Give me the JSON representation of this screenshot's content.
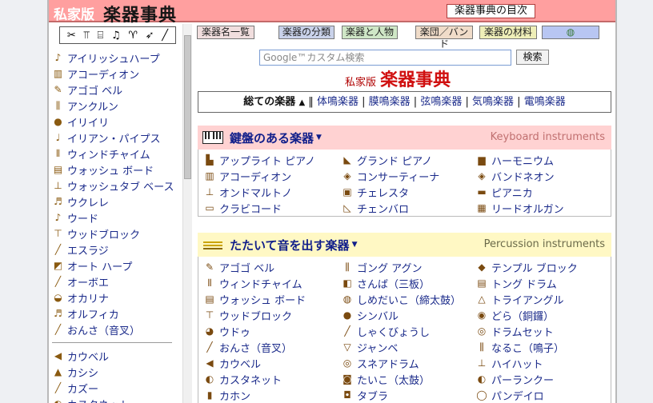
{
  "header": {
    "site_prefix": "私家版",
    "site_title": "楽器事典",
    "toc_link": "楽器事典の目次"
  },
  "tabs": [
    {
      "label": "楽器名一覧",
      "color": "#f1dede"
    },
    {
      "label": "楽器の分類",
      "color": "#c9d2ea"
    },
    {
      "label": "楽器と人物",
      "color": "#cfe7c6"
    },
    {
      "label": "楽団／バンド",
      "color": "#f0dcc9"
    },
    {
      "label": "楽器の材料",
      "color": "#efefb8"
    },
    {
      "label": "",
      "color": "#b8c6f2"
    }
  ],
  "search": {
    "placeholder": "Google™カスタム検索",
    "button": "検索"
  },
  "brand": {
    "prefix": "私家版",
    "title": "楽器事典"
  },
  "category_bar": {
    "all": "総ての楽器",
    "arrow": "▲",
    "items": [
      "体鳴楽器",
      "膜鳴楽器",
      "弦鳴楽器",
      "気鳴楽器",
      "電鳴楽器"
    ]
  },
  "sidebar": {
    "top_icons": [
      "horn-icon",
      "mallets-icon",
      "guitar-icon",
      "violin-icon",
      "lyre-icon",
      "flute-icon"
    ],
    "group1": [
      {
        "label": "アイリッシュハープ",
        "icon": "♪"
      },
      {
        "label": "アコーディオン",
        "icon": "▥"
      },
      {
        "label": "アゴゴ ベル",
        "icon": "✎"
      },
      {
        "label": "アンクルン",
        "icon": "⫼"
      },
      {
        "label": "イリイリ",
        "icon": "●"
      },
      {
        "label": "イリアン・パイプス",
        "icon": "♩"
      },
      {
        "label": "ウィンドチャイム",
        "icon": "⫴"
      },
      {
        "label": "ウォッシュ ボード",
        "icon": "▤"
      },
      {
        "label": "ウォッシュタブ ベース",
        "icon": "⊥"
      },
      {
        "label": "ウクレレ",
        "icon": "♬"
      },
      {
        "label": "ウード",
        "icon": "♪"
      },
      {
        "label": "ウッドブロック",
        "icon": "⊤"
      },
      {
        "label": "エスラジ",
        "icon": "╱"
      },
      {
        "label": "オート ハープ",
        "icon": "◩"
      },
      {
        "label": "オーボエ",
        "icon": "╱"
      },
      {
        "label": "オカリナ",
        "icon": "◒"
      },
      {
        "label": "オルフィカ",
        "icon": "♬"
      },
      {
        "label": "おんさ（音叉）",
        "icon": "╱"
      }
    ],
    "group2": [
      {
        "label": "カウベル",
        "icon": "◀"
      },
      {
        "label": "カシシ",
        "icon": "▲"
      },
      {
        "label": "カズー",
        "icon": "╱"
      },
      {
        "label": "カスタネット",
        "icon": "◐"
      }
    ]
  },
  "keyboard_panel": {
    "title_jp": "鍵盤のある楽器",
    "title_en": "Keyboard instruments",
    "bg": "#ffd2d2",
    "en_color": "#c07070",
    "items": [
      {
        "label": "アップライト ピアノ",
        "icon": "▙"
      },
      {
        "label": "グランド ピアノ",
        "icon": "◣"
      },
      {
        "label": "ハーモニウム",
        "icon": "▆"
      },
      {
        "label": "アコーディオン",
        "icon": "▥"
      },
      {
        "label": "コンサーティーナ",
        "icon": "◈"
      },
      {
        "label": "バンドネオン",
        "icon": "◈"
      },
      {
        "label": "オンドマルトノ",
        "icon": "⊥"
      },
      {
        "label": "チェレスタ",
        "icon": "▣"
      },
      {
        "label": "ピアニカ",
        "icon": "▬"
      },
      {
        "label": "クラビコード",
        "icon": "▭"
      },
      {
        "label": "チェンバロ",
        "icon": "◺"
      },
      {
        "label": "リードオルガン",
        "icon": "▦"
      }
    ]
  },
  "percussion_panel": {
    "title_jp": "たたいて音を出す楽器",
    "title_en": "Percussion instruments",
    "bg": "#fff8c4",
    "en_color": "#6a6a4a",
    "items": [
      {
        "label": "アゴゴ ベル",
        "icon": "✎"
      },
      {
        "label": "ゴング アグン",
        "icon": "⫼"
      },
      {
        "label": "テンプル ブロック",
        "icon": "◆"
      },
      {
        "label": "ウィンドチャイム",
        "icon": "⫴"
      },
      {
        "label": "さんば（三板）",
        "icon": "◧"
      },
      {
        "label": "トング ドラム",
        "icon": "▤"
      },
      {
        "label": "ウォッシュ ボード",
        "icon": "▤"
      },
      {
        "label": "しめだいこ（締太鼓）",
        "icon": "◍"
      },
      {
        "label": "トライアングル",
        "icon": "△"
      },
      {
        "label": "ウッドブロック",
        "icon": "⊤"
      },
      {
        "label": "シンバル",
        "icon": "●"
      },
      {
        "label": "どら（銅鑼）",
        "icon": "◉"
      },
      {
        "label": "ウドゥ",
        "icon": "◕"
      },
      {
        "label": "しゃくびょうし",
        "icon": "╱"
      },
      {
        "label": "ドラムセット",
        "icon": "◎"
      },
      {
        "label": "おんさ（音叉）",
        "icon": "╱"
      },
      {
        "label": "ジャンベ",
        "icon": "▽"
      },
      {
        "label": "なるこ（鳴子）",
        "icon": "⫼"
      },
      {
        "label": "カウベル",
        "icon": "◀"
      },
      {
        "label": "スネアドラム",
        "icon": "◎"
      },
      {
        "label": "ハイハット",
        "icon": "⊥"
      },
      {
        "label": "カスタネット",
        "icon": "◐"
      },
      {
        "label": "たいこ（太鼓）",
        "icon": "◙"
      },
      {
        "label": "パーランクー",
        "icon": "◐"
      },
      {
        "label": "カホン",
        "icon": "▮"
      },
      {
        "label": "タブラ",
        "icon": "◘"
      },
      {
        "label": "パンデイロ",
        "icon": "◯"
      }
    ]
  }
}
